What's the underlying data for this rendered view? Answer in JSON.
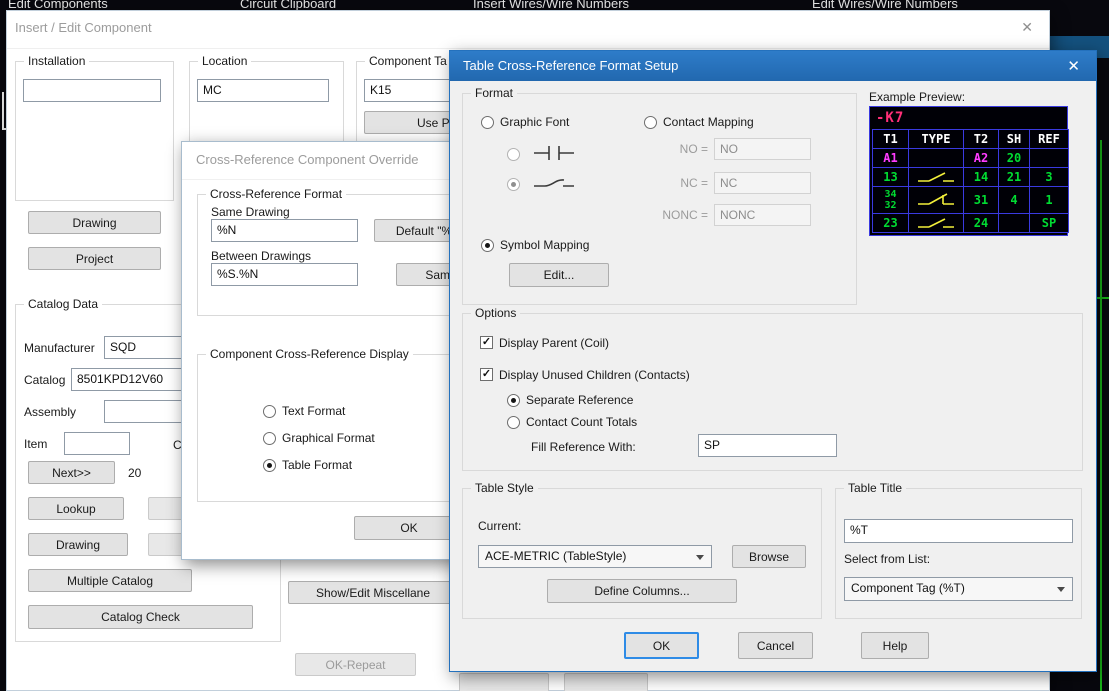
{
  "icons": {
    "close": "✕",
    "check": "✓"
  },
  "ribbon": {
    "items": [
      "Edit Components",
      "Circuit Clipboard",
      "Insert Wires/Wire Numbers",
      "Edit Wires/Wire Numbers"
    ]
  },
  "insert_edit": {
    "title": "Insert / Edit Component",
    "installation_label": "Installation",
    "installation_value": "",
    "location_label": "Location",
    "location_value": "MC",
    "component_tag_label": "Component Ta",
    "component_tag_value": "K15",
    "use_plc_button": "Use PLC",
    "drawing_button": "Drawing",
    "project_button": "Project",
    "catalog": {
      "group_label": "Catalog Data",
      "manufacturer_label": "Manufacturer",
      "manufacturer_value": "SQD",
      "catalog_label": "Catalog",
      "catalog_value": "8501KPD12V60",
      "assembly_label": "Assembly",
      "assembly_value": "",
      "item_label": "Item",
      "item_value": "",
      "count_label": "C",
      "next_button": "Next>>",
      "next_count": "20",
      "lookup_button": "Lookup",
      "drawing2_button": "Drawing",
      "multiple_catalog_button": "Multiple Catalog",
      "catalog_check_button": "Catalog Check"
    },
    "show_edit_misc_button": "Show/Edit Miscellane",
    "ok_repeat_button": "OK-Repeat"
  },
  "override": {
    "title": "Cross-Reference Component Override",
    "format_group_label": "Cross-Reference Format",
    "same_drawing_label": "Same Drawing",
    "same_drawing_value": "%N",
    "default_button": "Default \"%",
    "between_drawings_label": "Between Drawings",
    "between_drawings_value": "%S.%N",
    "same_button": "Same",
    "display_group_label": "Component Cross-Reference Display",
    "text_format_label": "Text Format",
    "graphical_format_label": "Graphical Format",
    "table_format_label": "Table Format",
    "ok_button": "OK"
  },
  "table_setup": {
    "title": "Table Cross-Reference Format Setup",
    "format": {
      "group_label": "Format",
      "graphic_font_label": "Graphic Font",
      "contact_mapping_label": "Contact Mapping",
      "no_label": "NO =",
      "no_value": "NO",
      "nc_label": "NC =",
      "nc_value": "NC",
      "nonc_label": "NONC =",
      "nonc_value": "NONC",
      "symbol_mapping_label": "Symbol Mapping",
      "edit_button": "Edit..."
    },
    "preview": {
      "label": "Example Preview:",
      "tag": "-K7",
      "headers": [
        "T1",
        "TYPE",
        "T2",
        "SH",
        "REF"
      ],
      "rows": [
        [
          "A1",
          "",
          "A2",
          "20",
          ""
        ],
        [
          "13",
          "",
          "14",
          "21",
          "3"
        ],
        [
          "34\n32",
          "",
          "31",
          "4",
          "1"
        ],
        [
          "23",
          "",
          "24",
          "",
          "SP"
        ]
      ]
    },
    "options": {
      "group_label": "Options",
      "display_parent_label": "Display Parent (Coil)",
      "display_unused_label": "Display Unused Children (Contacts)",
      "separate_reference_label": "Separate Reference",
      "contact_count_label": "Contact Count Totals",
      "fill_reference_label": "Fill Reference With:",
      "fill_reference_value": "SP"
    },
    "table_style": {
      "group_label": "Table Style",
      "current_label": "Current:",
      "current_value": "ACE-METRIC (TableStyle)",
      "browse_button": "Browse",
      "define_columns_button": "Define Columns..."
    },
    "table_title": {
      "group_label": "Table Title",
      "value": "%T",
      "select_label": "Select from List:",
      "select_value": "Component Tag (%T)"
    },
    "ok_button": "OK",
    "cancel_button": "Cancel",
    "help_button": "Help"
  }
}
